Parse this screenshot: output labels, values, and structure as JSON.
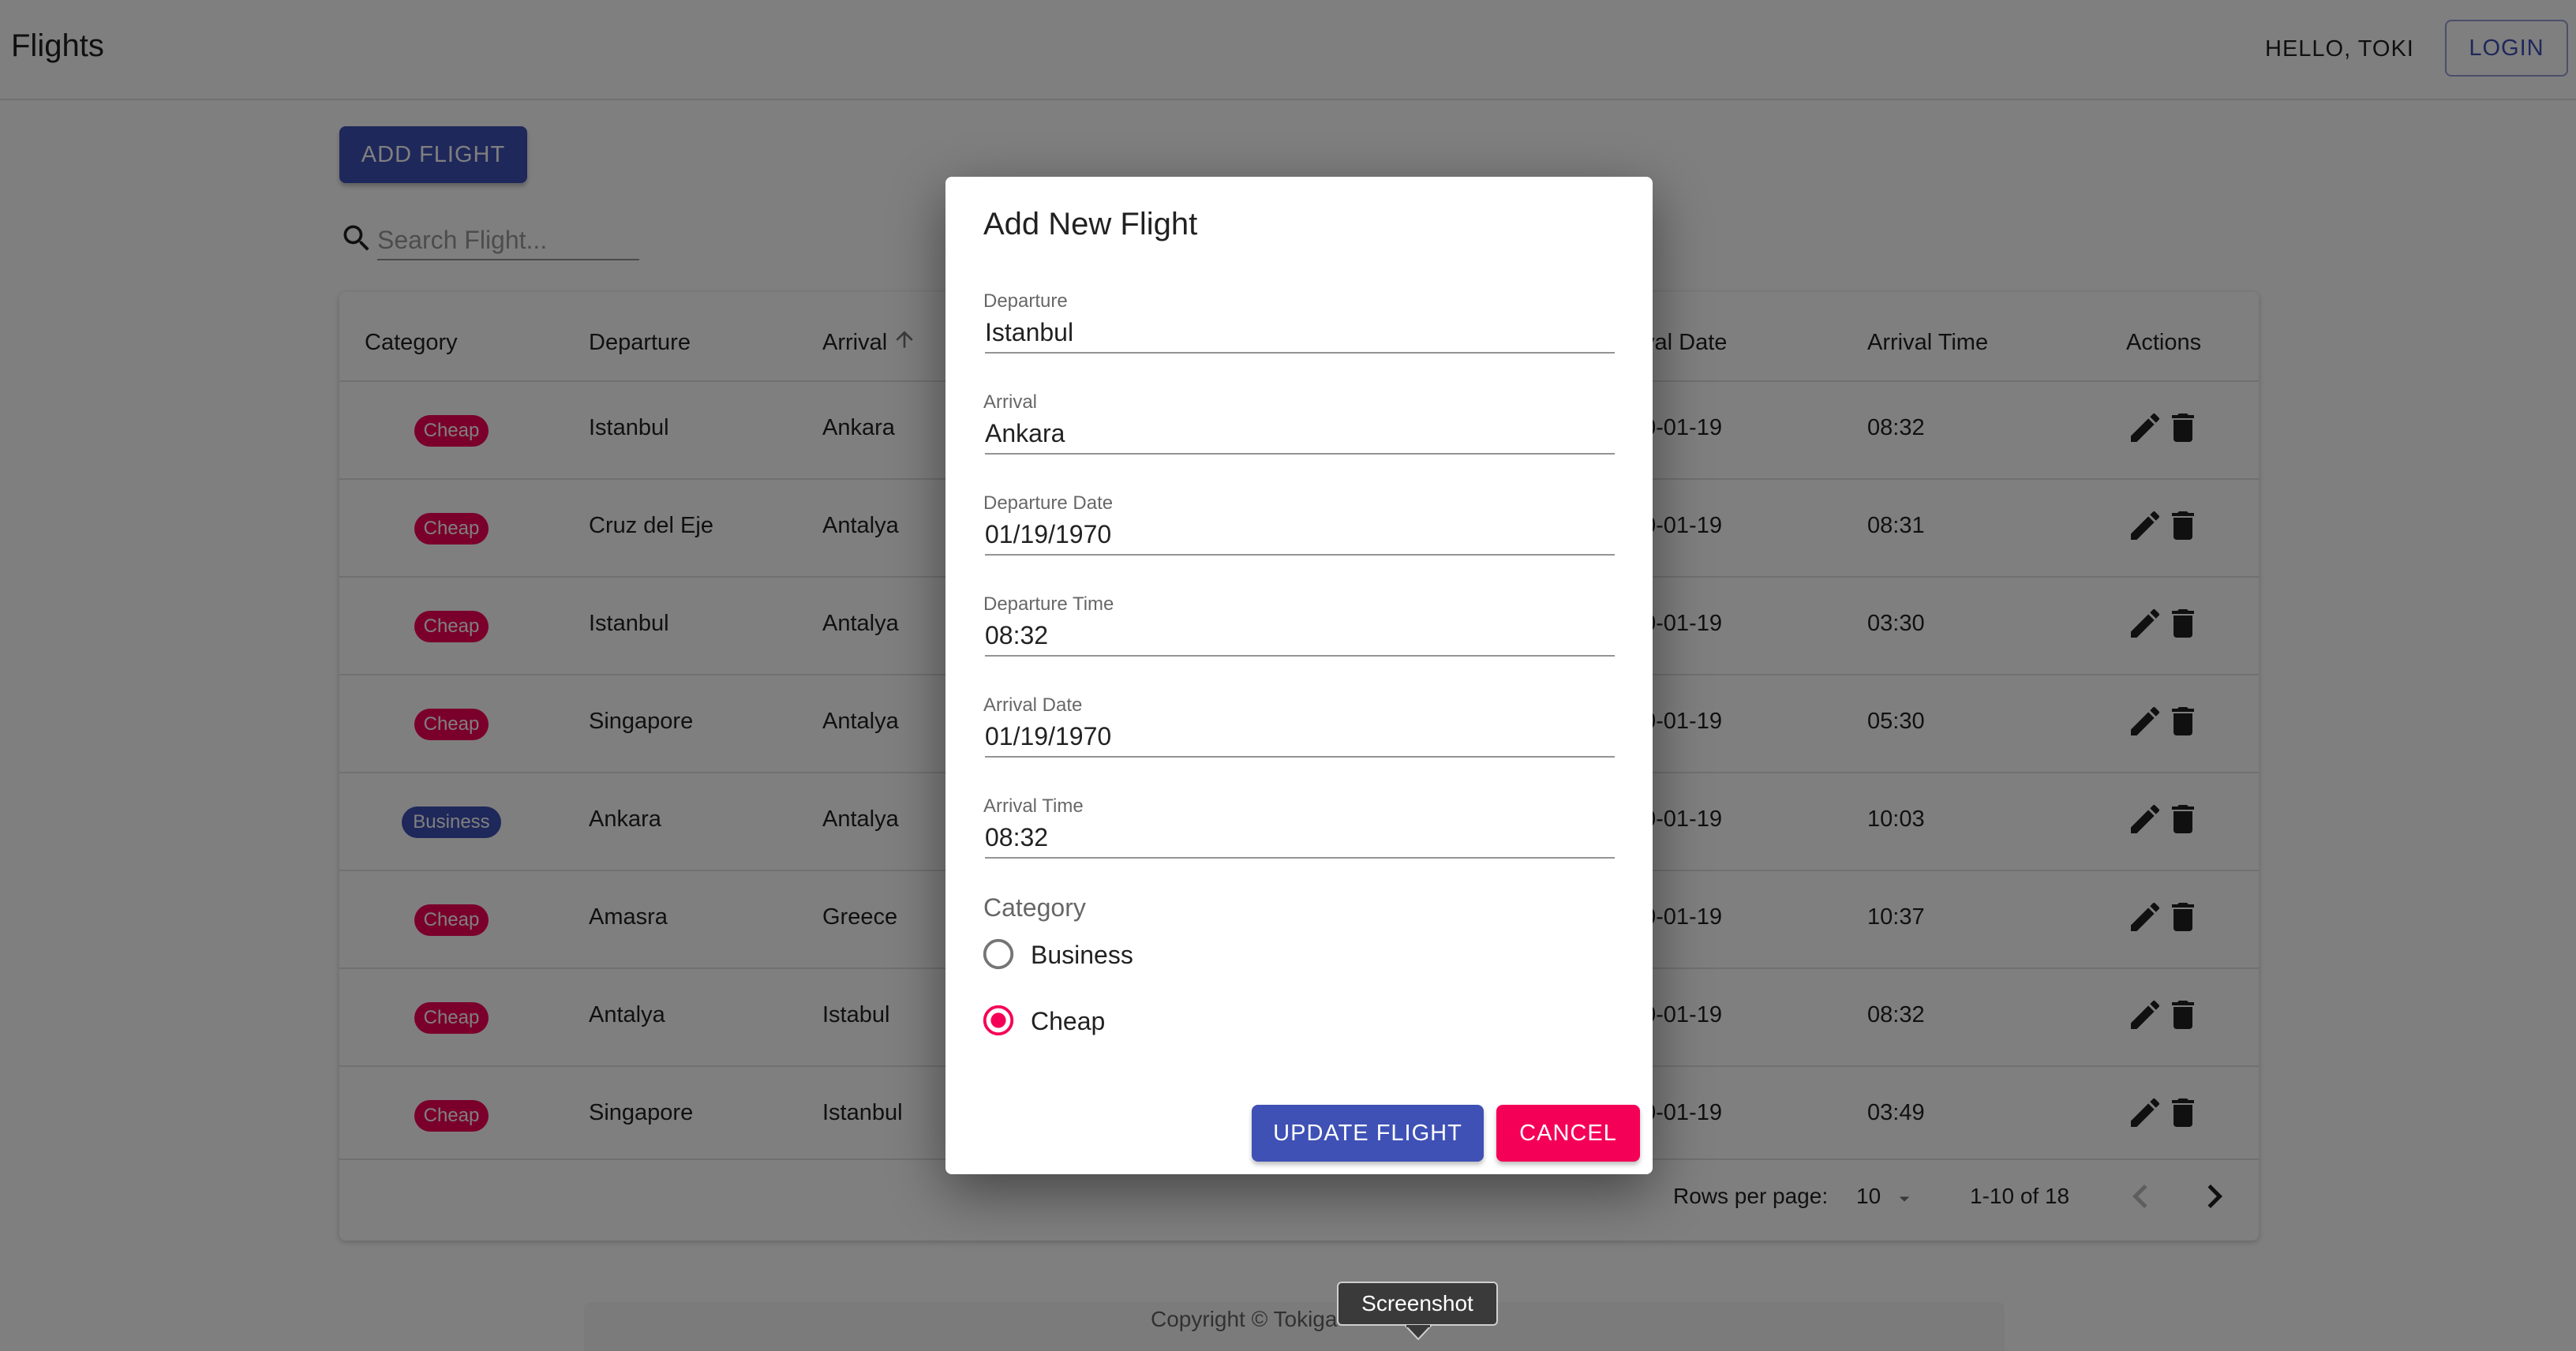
{
  "app": {
    "title": "Flights",
    "greeting": "HELLO, TOKI",
    "login_label": "LOGIN"
  },
  "toolbar": {
    "add_flight_label": "ADD FLIGHT",
    "search_placeholder": "Search Flight...",
    "search_value": ""
  },
  "table": {
    "columns": [
      {
        "label": "Category"
      },
      {
        "label": "Departure"
      },
      {
        "label": "Arrival"
      },
      {
        "label": "val Date"
      },
      {
        "label": "Arrival Time"
      },
      {
        "label": "Actions"
      }
    ],
    "sorted_column": "Arrival",
    "sort_direction": "ascending",
    "rows": [
      {
        "category": "Cheap",
        "departure": "Istanbul",
        "arrival": "Ankara",
        "arrival_date": "0-01-19",
        "arrival_time": "08:32"
      },
      {
        "category": "Cheap",
        "departure": "Cruz del Eje",
        "arrival": "Antalya",
        "arrival_date": "0-01-19",
        "arrival_time": "08:31"
      },
      {
        "category": "Cheap",
        "departure": "Istanbul",
        "arrival": "Antalya",
        "arrival_date": "0-01-19",
        "arrival_time": "03:30"
      },
      {
        "category": "Cheap",
        "departure": "Singapore",
        "arrival": "Antalya",
        "arrival_date": "0-01-19",
        "arrival_time": "05:30"
      },
      {
        "category": "Business",
        "departure": "Ankara",
        "arrival": "Antalya",
        "arrival_date": "0-01-19",
        "arrival_time": "10:03"
      },
      {
        "category": "Cheap",
        "departure": "Amasra",
        "arrival": "Greece",
        "arrival_date": "0-01-19",
        "arrival_time": "10:37"
      },
      {
        "category": "Cheap",
        "departure": "Antalya",
        "arrival": "Istabul",
        "arrival_date": "0-01-19",
        "arrival_time": "08:32"
      },
      {
        "category": "Cheap",
        "departure": "Singapore",
        "arrival": "Istanbul",
        "arrival_date": "0-01-19",
        "arrival_time": "03:49"
      }
    ],
    "pagination": {
      "rows_per_page_label": "Rows per page:",
      "rows_per_page": "10",
      "range": "1-10 of 18"
    }
  },
  "footer": {
    "copyright": "Copyright © Tokiga"
  },
  "dialog": {
    "title": "Add New Flight",
    "fields": [
      {
        "label": "Departure",
        "value": "Istanbul"
      },
      {
        "label": "Arrival",
        "value": "Ankara"
      },
      {
        "label": "Departure Date",
        "value": "01/19/1970"
      },
      {
        "label": "Departure Time",
        "value": "08:32"
      },
      {
        "label": "Arrival Date",
        "value": "01/19/1970"
      },
      {
        "label": "Arrival Time",
        "value": "08:32"
      }
    ],
    "category_label": "Category",
    "category_options": [
      {
        "label": "Business",
        "selected": false
      },
      {
        "label": "Cheap",
        "selected": true
      }
    ],
    "update_label": "UPDATE FLIGHT",
    "cancel_label": "CANCEL"
  },
  "tooltip": {
    "text": "Screenshot"
  },
  "colors": {
    "primary": "#3f51b5",
    "secondary": "#f50057",
    "backdrop": "rgba(0,0,0,0.5)"
  },
  "icons": [
    "search-icon",
    "sort-arrow-up-icon",
    "edit-pencil-icon",
    "delete-trash-icon",
    "dropdown-caret-icon",
    "chevron-left-icon",
    "chevron-right-icon",
    "radio-unchecked-icon",
    "radio-checked-icon"
  ]
}
